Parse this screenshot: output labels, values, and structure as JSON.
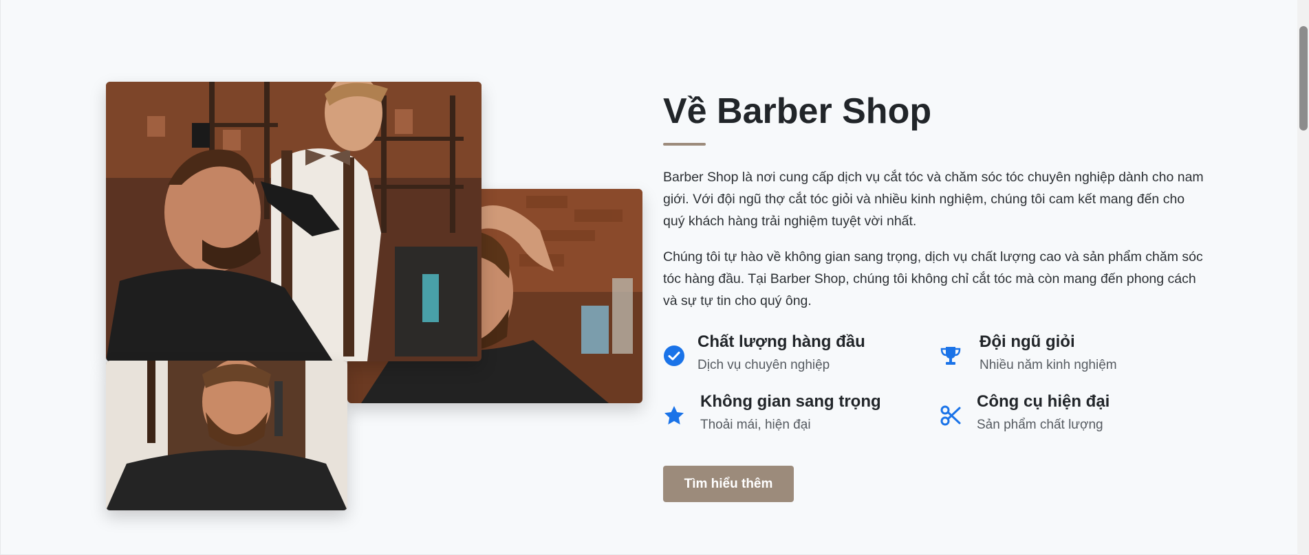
{
  "about": {
    "title": "Về Barber Shop",
    "paragraphs": [
      "Barber Shop là nơi cung cấp dịch vụ cắt tóc và chăm sóc tóc chuyên nghiệp dành cho nam giới. Với đội ngũ thợ cắt tóc giỏi và nhiều kinh nghiệm, chúng tôi cam kết mang đến cho quý khách hàng trải nghiệm tuyệt vời nhất.",
      "Chúng tôi tự hào về không gian sang trọng, dịch vụ chất lượng cao và sản phẩm chăm sóc tóc hàng đầu. Tại Barber Shop, chúng tôi không chỉ cắt tóc mà còn mang đến phong cách và sự tự tin cho quý ông."
    ],
    "features": [
      {
        "icon": "check-circle-icon",
        "title": "Chất lượng hàng đầu",
        "subtitle": "Dịch vụ chuyên nghiệp"
      },
      {
        "icon": "trophy-icon",
        "title": "Đội ngũ giỏi",
        "subtitle": "Nhiều năm kinh nghiệm"
      },
      {
        "icon": "star-icon",
        "title": "Không gian sang trọng",
        "subtitle": "Thoải mái, hiện đại"
      },
      {
        "icon": "scissors-icon",
        "title": "Công cụ hiện đại",
        "subtitle": "Sản phẩm chất lượng"
      }
    ],
    "button_label": "Tìm hiểu thêm"
  },
  "colors": {
    "accent": "#9c8b7b",
    "icon_blue": "#1a73e8",
    "background": "#f7f9fb",
    "text": "#212529"
  }
}
